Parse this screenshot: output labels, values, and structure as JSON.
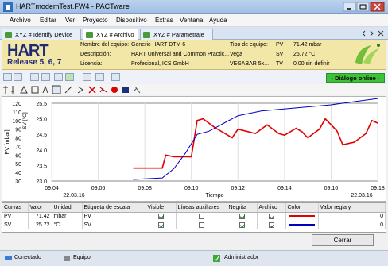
{
  "window": {
    "title": "HARTmodemTest.FW4 - PACTware"
  },
  "menu": [
    "Archivo",
    "Editar",
    "Ver",
    "Proyecto",
    "Dispositivo",
    "Extras",
    "Ventana",
    "Ayuda"
  ],
  "tabs": [
    "XYZ # Identify Device",
    "XYZ # Archivo",
    "XYZ # Parametraje"
  ],
  "header": {
    "logo_text": "HART",
    "release": "Release 5, 6, 7",
    "labels": [
      "Nombre del equipo:",
      "Descripción:",
      "Licencia:"
    ],
    "values": [
      "Generic HART DTM 6",
      "HART Universal and Common Practic...",
      "Profesional, ICS GmbH"
    ],
    "labels2": [
      "Tipo de equipo:",
      "Vega",
      "VEGABAR 5x..."
    ],
    "meas": [
      {
        "name": "PV",
        "value": "71.42 mbar"
      },
      {
        "name": "SV",
        "value": "25.72 °C"
      },
      {
        "name": "TV",
        "value": "0.00 sin definir"
      }
    ]
  },
  "status_online": "- Diálogo online -",
  "chart": {
    "xlabel": "Tiempo",
    "ylabel_left": "PV [mbar]",
    "ylabel_right": "SV [°C]",
    "left_ticks": [
      "120",
      "110",
      "100",
      "90",
      "80",
      "70",
      "60",
      "50",
      "40",
      "30"
    ],
    "right_ticks": [
      "25.5",
      "25.0",
      "24.5",
      "24.0",
      "23.5",
      "23.0"
    ],
    "x_ticks": [
      "09:04",
      "09:06",
      "09:08",
      "09:10",
      "09:12",
      "09:14",
      "09:16",
      "09:18"
    ],
    "date_left": "22.03.16",
    "date_right": "22.03.16"
  },
  "chart_data": {
    "type": "line",
    "xlabel": "Tiempo",
    "x": [
      "09:04",
      "09:06",
      "09:08",
      "09:10",
      "09:12",
      "09:14",
      "09:16",
      "09:18"
    ],
    "ylim": [
      30,
      120
    ],
    "y2lim": [
      23.0,
      25.5
    ],
    "series": [
      {
        "name": "PV",
        "color": "#e00000",
        "points": [
          [
            9.11,
            45
          ],
          [
            9.135,
            45
          ],
          [
            9.138,
            60
          ],
          [
            9.145,
            58
          ],
          [
            9.16,
            58
          ],
          [
            9.165,
            100
          ],
          [
            9.17,
            102
          ],
          [
            9.18,
            92
          ],
          [
            9.195,
            80
          ],
          [
            9.2,
            90
          ],
          [
            9.215,
            85
          ],
          [
            9.225,
            95
          ],
          [
            9.235,
            85
          ],
          [
            9.24,
            83
          ],
          [
            9.25,
            91
          ],
          [
            9.255,
            87
          ],
          [
            9.26,
            80
          ],
          [
            9.27,
            90
          ],
          [
            9.275,
            102
          ],
          [
            9.285,
            88
          ],
          [
            9.29,
            72
          ],
          [
            9.3,
            75
          ],
          [
            9.31,
            85
          ],
          [
            9.315,
            100
          ],
          [
            9.32,
            97
          ]
        ]
      },
      {
        "name": "SV",
        "color": "#0000c0",
        "points": [
          [
            9.11,
            23.05
          ],
          [
            9.135,
            23.1
          ],
          [
            9.145,
            23.4
          ],
          [
            9.155,
            23.9
          ],
          [
            9.165,
            24.5
          ],
          [
            9.175,
            24.6
          ],
          [
            9.18,
            24.7
          ],
          [
            9.19,
            24.9
          ],
          [
            9.2,
            25.1
          ],
          [
            9.22,
            25.25
          ],
          [
            9.25,
            25.35
          ],
          [
            9.28,
            25.45
          ],
          [
            9.3,
            25.55
          ],
          [
            9.32,
            25.65
          ]
        ]
      }
    ]
  },
  "table": {
    "headers": [
      "Curvas",
      "Valor",
      "Unidad",
      "Etiqueta de escala",
      "Visible",
      "Líneas auxiliares",
      "Negrita",
      "Archivo",
      "Color",
      "Valor regla y"
    ],
    "rows": [
      {
        "curve": "PV",
        "value": "71.42",
        "unit": "mbar",
        "scale": "PV",
        "visible": true,
        "aux": false,
        "bold": true,
        "archive": true,
        "color": "#e00000",
        "rule": "0"
      },
      {
        "curve": "SV",
        "value": "25.72",
        "unit": "°C",
        "scale": "SV",
        "visible": true,
        "aux": false,
        "bold": true,
        "archive": true,
        "color": "#0000c0",
        "rule": "0"
      }
    ]
  },
  "close_button": "Cerrar",
  "statusbar": [
    "Conectado",
    "Equipo",
    "Administrador"
  ]
}
